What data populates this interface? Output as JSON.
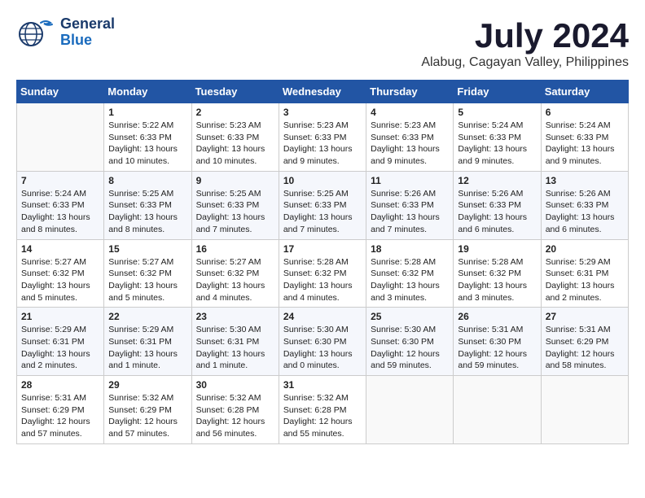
{
  "logo": {
    "line1": "General",
    "line2": "Blue"
  },
  "title": "July 2024",
  "subtitle": "Alabug, Cagayan Valley, Philippines",
  "weekdays": [
    "Sunday",
    "Monday",
    "Tuesday",
    "Wednesday",
    "Thursday",
    "Friday",
    "Saturday"
  ],
  "weeks": [
    [
      {
        "day": "",
        "info": ""
      },
      {
        "day": "1",
        "info": "Sunrise: 5:22 AM\nSunset: 6:33 PM\nDaylight: 13 hours\nand 10 minutes."
      },
      {
        "day": "2",
        "info": "Sunrise: 5:23 AM\nSunset: 6:33 PM\nDaylight: 13 hours\nand 10 minutes."
      },
      {
        "day": "3",
        "info": "Sunrise: 5:23 AM\nSunset: 6:33 PM\nDaylight: 13 hours\nand 9 minutes."
      },
      {
        "day": "4",
        "info": "Sunrise: 5:23 AM\nSunset: 6:33 PM\nDaylight: 13 hours\nand 9 minutes."
      },
      {
        "day": "5",
        "info": "Sunrise: 5:24 AM\nSunset: 6:33 PM\nDaylight: 13 hours\nand 9 minutes."
      },
      {
        "day": "6",
        "info": "Sunrise: 5:24 AM\nSunset: 6:33 PM\nDaylight: 13 hours\nand 9 minutes."
      }
    ],
    [
      {
        "day": "7",
        "info": "Sunrise: 5:24 AM\nSunset: 6:33 PM\nDaylight: 13 hours\nand 8 minutes."
      },
      {
        "day": "8",
        "info": "Sunrise: 5:25 AM\nSunset: 6:33 PM\nDaylight: 13 hours\nand 8 minutes."
      },
      {
        "day": "9",
        "info": "Sunrise: 5:25 AM\nSunset: 6:33 PM\nDaylight: 13 hours\nand 7 minutes."
      },
      {
        "day": "10",
        "info": "Sunrise: 5:25 AM\nSunset: 6:33 PM\nDaylight: 13 hours\nand 7 minutes."
      },
      {
        "day": "11",
        "info": "Sunrise: 5:26 AM\nSunset: 6:33 PM\nDaylight: 13 hours\nand 7 minutes."
      },
      {
        "day": "12",
        "info": "Sunrise: 5:26 AM\nSunset: 6:33 PM\nDaylight: 13 hours\nand 6 minutes."
      },
      {
        "day": "13",
        "info": "Sunrise: 5:26 AM\nSunset: 6:33 PM\nDaylight: 13 hours\nand 6 minutes."
      }
    ],
    [
      {
        "day": "14",
        "info": "Sunrise: 5:27 AM\nSunset: 6:32 PM\nDaylight: 13 hours\nand 5 minutes."
      },
      {
        "day": "15",
        "info": "Sunrise: 5:27 AM\nSunset: 6:32 PM\nDaylight: 13 hours\nand 5 minutes."
      },
      {
        "day": "16",
        "info": "Sunrise: 5:27 AM\nSunset: 6:32 PM\nDaylight: 13 hours\nand 4 minutes."
      },
      {
        "day": "17",
        "info": "Sunrise: 5:28 AM\nSunset: 6:32 PM\nDaylight: 13 hours\nand 4 minutes."
      },
      {
        "day": "18",
        "info": "Sunrise: 5:28 AM\nSunset: 6:32 PM\nDaylight: 13 hours\nand 3 minutes."
      },
      {
        "day": "19",
        "info": "Sunrise: 5:28 AM\nSunset: 6:32 PM\nDaylight: 13 hours\nand 3 minutes."
      },
      {
        "day": "20",
        "info": "Sunrise: 5:29 AM\nSunset: 6:31 PM\nDaylight: 13 hours\nand 2 minutes."
      }
    ],
    [
      {
        "day": "21",
        "info": "Sunrise: 5:29 AM\nSunset: 6:31 PM\nDaylight: 13 hours\nand 2 minutes."
      },
      {
        "day": "22",
        "info": "Sunrise: 5:29 AM\nSunset: 6:31 PM\nDaylight: 13 hours\nand 1 minute."
      },
      {
        "day": "23",
        "info": "Sunrise: 5:30 AM\nSunset: 6:31 PM\nDaylight: 13 hours\nand 1 minute."
      },
      {
        "day": "24",
        "info": "Sunrise: 5:30 AM\nSunset: 6:30 PM\nDaylight: 13 hours\nand 0 minutes."
      },
      {
        "day": "25",
        "info": "Sunrise: 5:30 AM\nSunset: 6:30 PM\nDaylight: 12 hours\nand 59 minutes."
      },
      {
        "day": "26",
        "info": "Sunrise: 5:31 AM\nSunset: 6:30 PM\nDaylight: 12 hours\nand 59 minutes."
      },
      {
        "day": "27",
        "info": "Sunrise: 5:31 AM\nSunset: 6:29 PM\nDaylight: 12 hours\nand 58 minutes."
      }
    ],
    [
      {
        "day": "28",
        "info": "Sunrise: 5:31 AM\nSunset: 6:29 PM\nDaylight: 12 hours\nand 57 minutes."
      },
      {
        "day": "29",
        "info": "Sunrise: 5:32 AM\nSunset: 6:29 PM\nDaylight: 12 hours\nand 57 minutes."
      },
      {
        "day": "30",
        "info": "Sunrise: 5:32 AM\nSunset: 6:28 PM\nDaylight: 12 hours\nand 56 minutes."
      },
      {
        "day": "31",
        "info": "Sunrise: 5:32 AM\nSunset: 6:28 PM\nDaylight: 12 hours\nand 55 minutes."
      },
      {
        "day": "",
        "info": ""
      },
      {
        "day": "",
        "info": ""
      },
      {
        "day": "",
        "info": ""
      }
    ]
  ]
}
